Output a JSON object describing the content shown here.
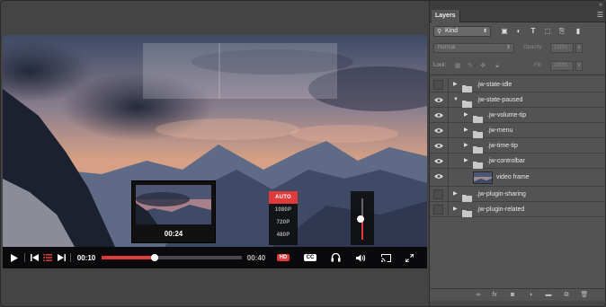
{
  "player": {
    "current_time": "00:10",
    "duration": "00:40",
    "progress": 0.38,
    "thumbnail_time": "00:24",
    "quality_options": [
      "AUTO",
      "1080P",
      "720P",
      "480P"
    ],
    "selected_quality": "AUTO",
    "volume_level": 0.5,
    "hd_label": "HD",
    "cc_label": "CC",
    "accent_color": "#e03a3a",
    "icons": [
      "play-icon",
      "rewind-icon",
      "playlist-icon",
      "next-icon",
      "audio-tracks-icon",
      "volume-icon",
      "cast-icon",
      "fullscreen-icon"
    ]
  },
  "layers_panel": {
    "tab_label": "Layers",
    "filter_kind": "Kind",
    "blend_mode": "Normal",
    "opacity_label": "Opacity:",
    "opacity_value": "100%",
    "lock_label": "Lock:",
    "fill_label": "Fill:",
    "fill_value": "100%",
    "layers": [
      {
        "name": ".jw-state-idle",
        "visible": false,
        "expanded": false,
        "indent": 0,
        "type": "group"
      },
      {
        "name": ".jw-state-paused",
        "visible": true,
        "expanded": true,
        "indent": 0,
        "type": "group"
      },
      {
        "name": ".jw-volume-tip",
        "visible": true,
        "expanded": false,
        "indent": 1,
        "type": "group"
      },
      {
        "name": ".jw-menu",
        "visible": true,
        "expanded": false,
        "indent": 1,
        "type": "group"
      },
      {
        "name": ".jw-time-tip",
        "visible": true,
        "expanded": false,
        "indent": 1,
        "type": "group"
      },
      {
        "name": ".jw-controlbar",
        "visible": true,
        "expanded": false,
        "indent": 1,
        "type": "group"
      },
      {
        "name": "video frame",
        "visible": true,
        "expanded": false,
        "indent": 1,
        "type": "image"
      },
      {
        "name": ".jw-plugin-sharing",
        "visible": false,
        "expanded": false,
        "indent": 0,
        "type": "group"
      },
      {
        "name": ".jw-plugin-related",
        "visible": false,
        "expanded": false,
        "indent": 0,
        "type": "group"
      }
    ]
  }
}
